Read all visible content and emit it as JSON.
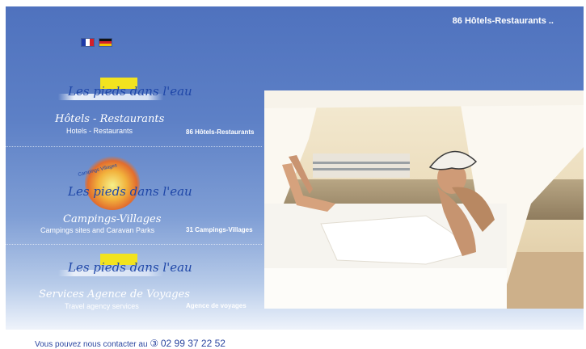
{
  "header": {
    "title": "86 Hôtels-Restaurants .."
  },
  "languages": [
    {
      "code": "fr",
      "colors": [
        "#1d3aa8",
        "#ffffff",
        "#d4202a"
      ]
    },
    {
      "code": "de",
      "colors": [
        "#111111",
        "#d4202a",
        "#f2c300"
      ]
    }
  ],
  "logo_text": "Les pieds dans l'eau",
  "sections": [
    {
      "script_title": "Hôtels - Restaurants",
      "subtitle": "Hotels - Restaurants",
      "link": "86 Hôtels-Restaurants"
    },
    {
      "badge": "Campings Villages",
      "script_title": "Campings-Villages",
      "subtitle": "Campings sites and Caravan Parks",
      "link": "31 Campings-Villages"
    },
    {
      "script_title": "Services Agence de Voyages",
      "subtitle": "Travel agency services",
      "link": "Agence de voyages"
    }
  ],
  "contact": {
    "text": "Vous pouvez nous contacter au",
    "phone_icon": "③",
    "phone": "02 99 37 22 52"
  },
  "colors": {
    "panel_top": "#4f72be",
    "logo_blue": "#1f47a8",
    "logo_yellow": "#f2e31f"
  }
}
